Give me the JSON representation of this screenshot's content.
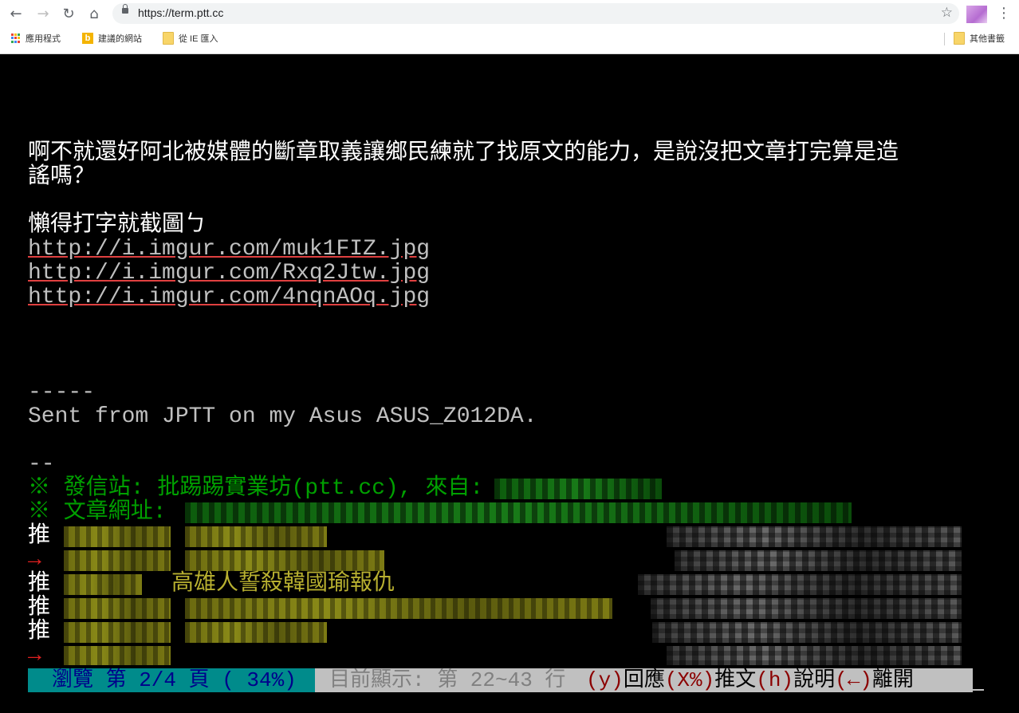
{
  "browser": {
    "url": "https://term.ptt.cc",
    "bookmarks": [
      {
        "label": "應用程式",
        "icon": "apps-icon"
      },
      {
        "label": "建議的網站",
        "icon": "bing-icon"
      },
      {
        "label": "從 IE 匯入",
        "icon": "folder-icon"
      },
      {
        "label": "其他書籤",
        "icon": "folder-icon"
      }
    ]
  },
  "article": {
    "line1": "啊不就還好阿北被媒體的斷章取義讓鄉民練就了找原文的能力，是說沒把文章打完算是造",
    "line2": "謠嗎？",
    "line3": "懶得打字就截圖ㄅ",
    "links": [
      "http://i.imgur.com/muk1FIZ.jpg",
      "http://i.imgur.com/Rxq2Jtw.jpg",
      "http://i.imgur.com/4nqnAOq.jpg"
    ],
    "sig_dashes": "-----",
    "sig_text": "Sent from JPTT on my Asus ASUS_Z012DA.",
    "sig_sep": "--",
    "origin_label": "※ 發信站: 批踢踢實業坊(ptt.cc), 來自:",
    "url_label": "※ 文章網址:"
  },
  "pushes": [
    {
      "tag": "推",
      "content": ""
    },
    {
      "tag": "→",
      "content": ""
    },
    {
      "tag": "推",
      "content": "高雄人誓殺韓國瑜報仇"
    },
    {
      "tag": "推",
      "content": ""
    },
    {
      "tag": "推",
      "content": ""
    },
    {
      "tag": "→",
      "content": ""
    }
  ],
  "status": {
    "browse": "瀏覽 第 2/4 頁 ( 34%)",
    "showing": "目前顯示: 第 22~43 行",
    "k_reply": "(y)",
    "reply": "回應",
    "k_push": "(X%)",
    "push": "推文",
    "k_help": "(h)",
    "help": "說明",
    "k_leave": "(←)",
    "leave": "離開"
  }
}
